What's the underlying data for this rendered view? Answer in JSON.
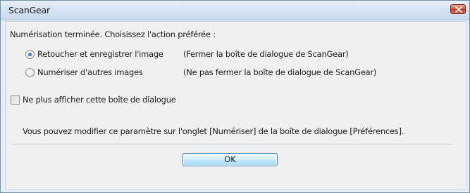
{
  "window": {
    "title": "ScanGear",
    "close_icon": "close-icon"
  },
  "dialog": {
    "prompt": "Numérisation terminée. Choisissez l'action préférée :",
    "options": [
      {
        "label": "Retoucher et enregistrer l'image",
        "description": "(Fermer la boîte de dialogue de ScanGear)",
        "selected": true
      },
      {
        "label": "Numériser d'autres images",
        "description": "(Ne pas fermer la boîte de dialogue de ScanGear)",
        "selected": false
      }
    ],
    "dont_show_again": {
      "label": "Ne plus afficher cette boîte de dialogue",
      "checked": false
    },
    "note": "Vous pouvez modifier ce paramètre sur l'onglet [Numériser] de la boîte de dialogue [Préférences].",
    "ok_label": "OK"
  },
  "colors": {
    "accent": "#3c7fb1",
    "close": "#c03e26"
  }
}
